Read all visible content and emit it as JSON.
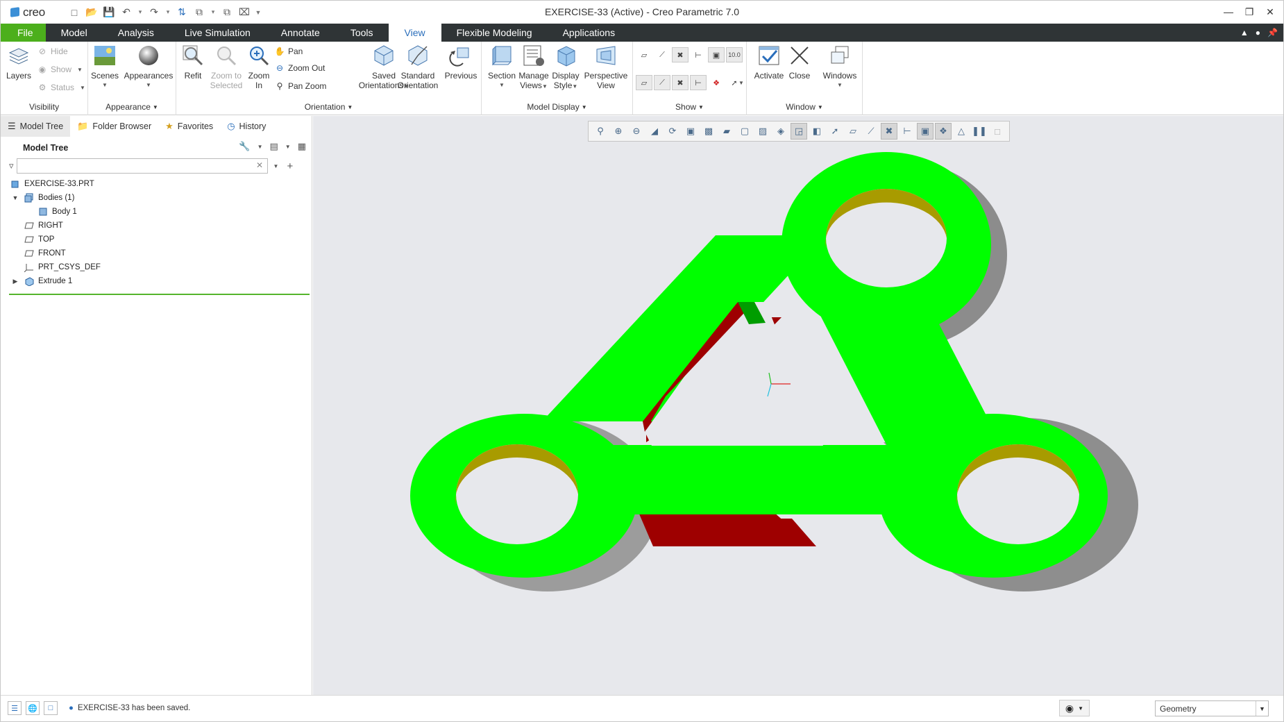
{
  "app": {
    "logo_text": "creo",
    "window_title": "EXERCISE-33 (Active) - Creo Parametric 7.0",
    "accent_color": "#4caf1c",
    "tabbar_color": "#2f3436"
  },
  "menu_tabs": [
    "File",
    "Model",
    "Analysis",
    "Live Simulation",
    "Annotate",
    "Tools",
    "View",
    "Flexible Modeling",
    "Applications"
  ],
  "active_tab": "View",
  "ribbon": {
    "visibility": {
      "title": "Visibility",
      "layers": "Layers",
      "hide": "Hide",
      "show": "Show",
      "status": "Status"
    },
    "appearance": {
      "title": "Appearance",
      "scenes": "Scenes",
      "appearances": "Appearances"
    },
    "orientation": {
      "title": "Orientation",
      "refit": "Refit",
      "zoom_to_selected_1": "Zoom to",
      "zoom_to_selected_2": "Selected",
      "zoom_in_1": "Zoom",
      "zoom_in_2": "In",
      "pan": "Pan",
      "zoom_out": "Zoom Out",
      "pan_zoom": "Pan Zoom",
      "saved_orientations_1": "Saved",
      "saved_orientations_2": "Orientations",
      "standard_orientation_1": "Standard",
      "standard_orientation_2": "Orientation",
      "previous": "Previous"
    },
    "model_display": {
      "title": "Model Display",
      "section": "Section",
      "manage_views_1": "Manage",
      "manage_views_2": "Views",
      "display_style_1": "Display",
      "display_style_2": "Style",
      "perspective_view_1": "Perspective",
      "perspective_view_2": "View"
    },
    "show": {
      "title": "Show",
      "datum_label": "10.0"
    },
    "window": {
      "title": "Window",
      "activate": "Activate",
      "close": "Close",
      "windows": "Windows"
    }
  },
  "navigator": {
    "tabs": [
      "Model Tree",
      "Folder Browser",
      "Favorites",
      "History"
    ],
    "panel_title": "Model Tree",
    "search_value": "",
    "tree": [
      {
        "label": "EXERCISE-33.PRT",
        "icon": "part-icon",
        "level": 0,
        "expander": ""
      },
      {
        "label": "Bodies (1)",
        "icon": "bodies-icon",
        "level": 0,
        "expander": "expanded"
      },
      {
        "label": "Body 1",
        "icon": "body-icon",
        "level": 1,
        "expander": ""
      },
      {
        "label": "RIGHT",
        "icon": "datum-plane-icon",
        "level": 0,
        "expander": ""
      },
      {
        "label": "TOP",
        "icon": "datum-plane-icon",
        "level": 0,
        "expander": ""
      },
      {
        "label": "FRONT",
        "icon": "datum-plane-icon",
        "level": 0,
        "expander": ""
      },
      {
        "label": "PRT_CSYS_DEF",
        "icon": "csys-icon",
        "level": 0,
        "expander": ""
      },
      {
        "label": "Extrude 1",
        "icon": "extrude-icon",
        "level": 0,
        "expander": "collapsed"
      }
    ]
  },
  "model_colors": {
    "top_face": "#00ff00",
    "inner_face": "#9e0000",
    "outer_wall": "#a8a8a8",
    "hole_wall": "#b0a000",
    "background": "#e7e8ec"
  },
  "status": {
    "message": "EXERCISE-33 has been saved.",
    "filter_value": "Geometry"
  }
}
